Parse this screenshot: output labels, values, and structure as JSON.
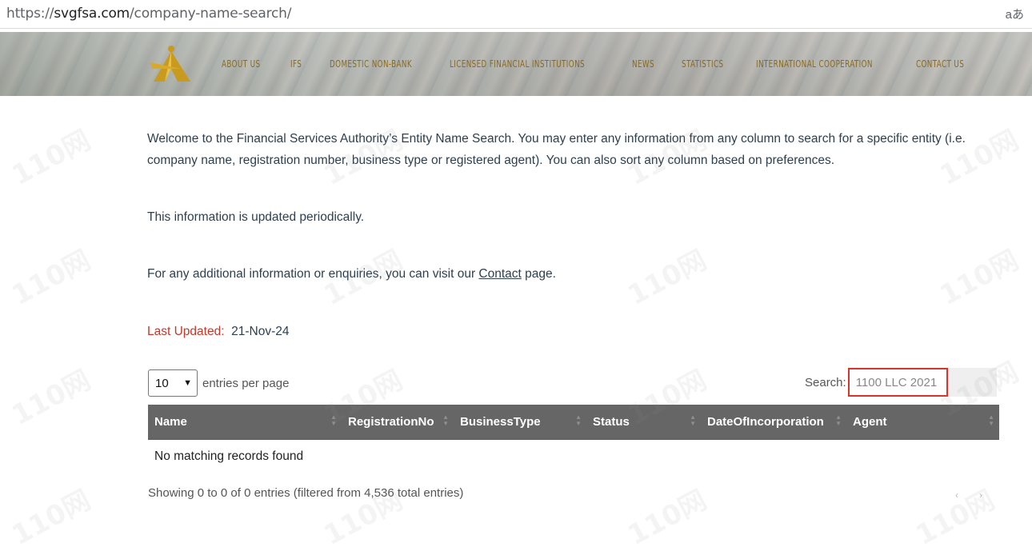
{
  "browser": {
    "url_scheme": "https://",
    "url_host": "svgfsa.com",
    "url_path": "/company-name-search/",
    "translate_glyph": "aあ"
  },
  "nav": {
    "items": [
      "ABOUT US",
      "IFS",
      "DOMESTIC NON-BANK",
      "LICENSED FINANCIAL INSTITUTIONS",
      "NEWS",
      "STATISTICS",
      "INTERNATIONAL COOPERATION",
      "CONTACT US"
    ]
  },
  "content": {
    "intro": "Welcome to the Financial Services Authority’s Entity Name Search. You may enter any information from any column to search for a specific entity (i.e. company name, registration number, business type or registered agent). You can also sort any column based on preferences.",
    "updated_note": "This information is updated periodically.",
    "enquiries_before": "For any additional information or enquiries, you can visit our ",
    "enquiries_link": "Contact",
    "enquiries_after": " page.",
    "last_updated_label": "Last Updated:",
    "last_updated_value": "21-Nov-24"
  },
  "table_controls": {
    "page_size": "10",
    "entries_label": "entries per page",
    "search_label": "Search:",
    "search_value": "1100 LLC 2021"
  },
  "table": {
    "columns": [
      "Name",
      "RegistrationNo",
      "BusinessType",
      "Status",
      "DateOfIncorporation",
      "Agent"
    ],
    "empty_message": "No matching records found",
    "info": "Showing 0 to 0 of 0 entries (filtered from 4,536 total entries)",
    "pager_prev": "‹",
    "pager_next": "›"
  },
  "watermark_text": "110网",
  "colors": {
    "nav_text": "#8a6a1c",
    "header_bg": "#666666",
    "last_updated_label": "#c0392b",
    "search_highlight": "#d9342b"
  }
}
